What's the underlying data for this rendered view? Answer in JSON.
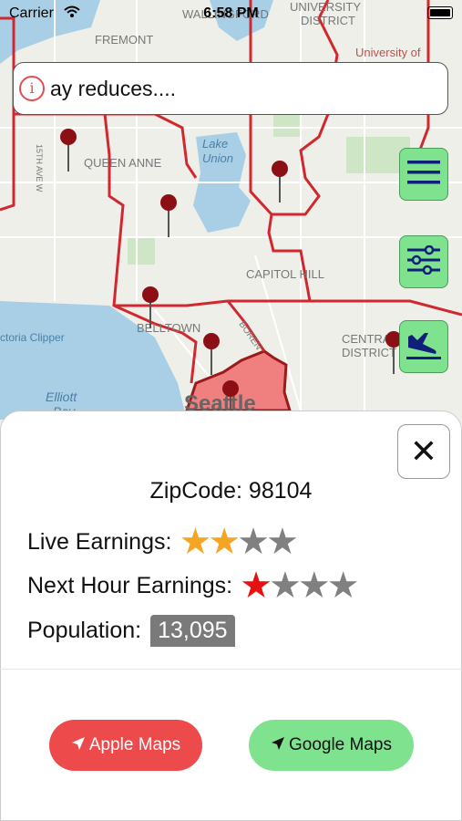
{
  "status_bar": {
    "carrier": "Carrier",
    "time": "6:58 PM"
  },
  "map": {
    "labels": [
      "FREMONT",
      "UNIVERSITY",
      "DISTRICT",
      "University of",
      "QUEEN ANNE",
      "Lake",
      "Union",
      "CAPITOL HILL",
      "BELLTOWN",
      "BOREN",
      "CENTRAL",
      "DISTRICT",
      "Elliott",
      "Bay",
      "Seattle",
      "ctoria Clipper",
      "15TH AVE W",
      "WALLINGFORD"
    ],
    "colors": {
      "water": "#a9cfe6",
      "land": "#efefea",
      "boundary": "#d0282e",
      "highlight": "#f08080"
    }
  },
  "search": {
    "text": "ay reduces...."
  },
  "side_buttons": [
    {
      "name": "menu",
      "icon": "hamburger-icon"
    },
    {
      "name": "filters",
      "icon": "sliders-icon"
    },
    {
      "name": "airport",
      "icon": "plane-landing-icon"
    }
  ],
  "detail": {
    "zipcode": "ZipCode: 98104",
    "live_label": "Live Earnings:",
    "live_rating": 2,
    "next_label": "Next Hour Earnings:",
    "next_rating": 1,
    "population_label": "Population:",
    "population_value": "13,095",
    "close_glyph": "✕"
  },
  "buttons": {
    "apple_label": "Apple Maps",
    "google_label": "Google Maps"
  },
  "colors": {
    "live_star": "#f5a524",
    "next_star": "#e81010",
    "empty_star": "#808080"
  }
}
